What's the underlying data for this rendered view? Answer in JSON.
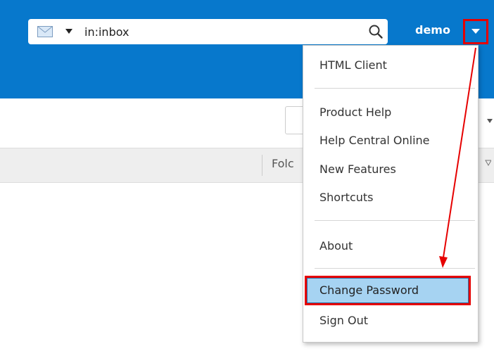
{
  "search": {
    "value": "in:inbox"
  },
  "header": {
    "user_name": "demo"
  },
  "list_header": {
    "column_partial": "Folc"
  },
  "menu": {
    "items": [
      {
        "label": "HTML Client"
      },
      {
        "label": "Product Help"
      },
      {
        "label": "Help Central Online"
      },
      {
        "label": "New Features"
      },
      {
        "label": "Shortcuts"
      },
      {
        "label": "About"
      },
      {
        "label": "Change Password"
      },
      {
        "label": "Sign Out"
      }
    ]
  },
  "icons": {
    "mail": "envelope-icon",
    "search": "search-icon",
    "caret": "caret-down-icon"
  },
  "colors": {
    "header_bg": "#0778cc",
    "highlight": "#a6d3f2",
    "annotation": "#e60000"
  }
}
